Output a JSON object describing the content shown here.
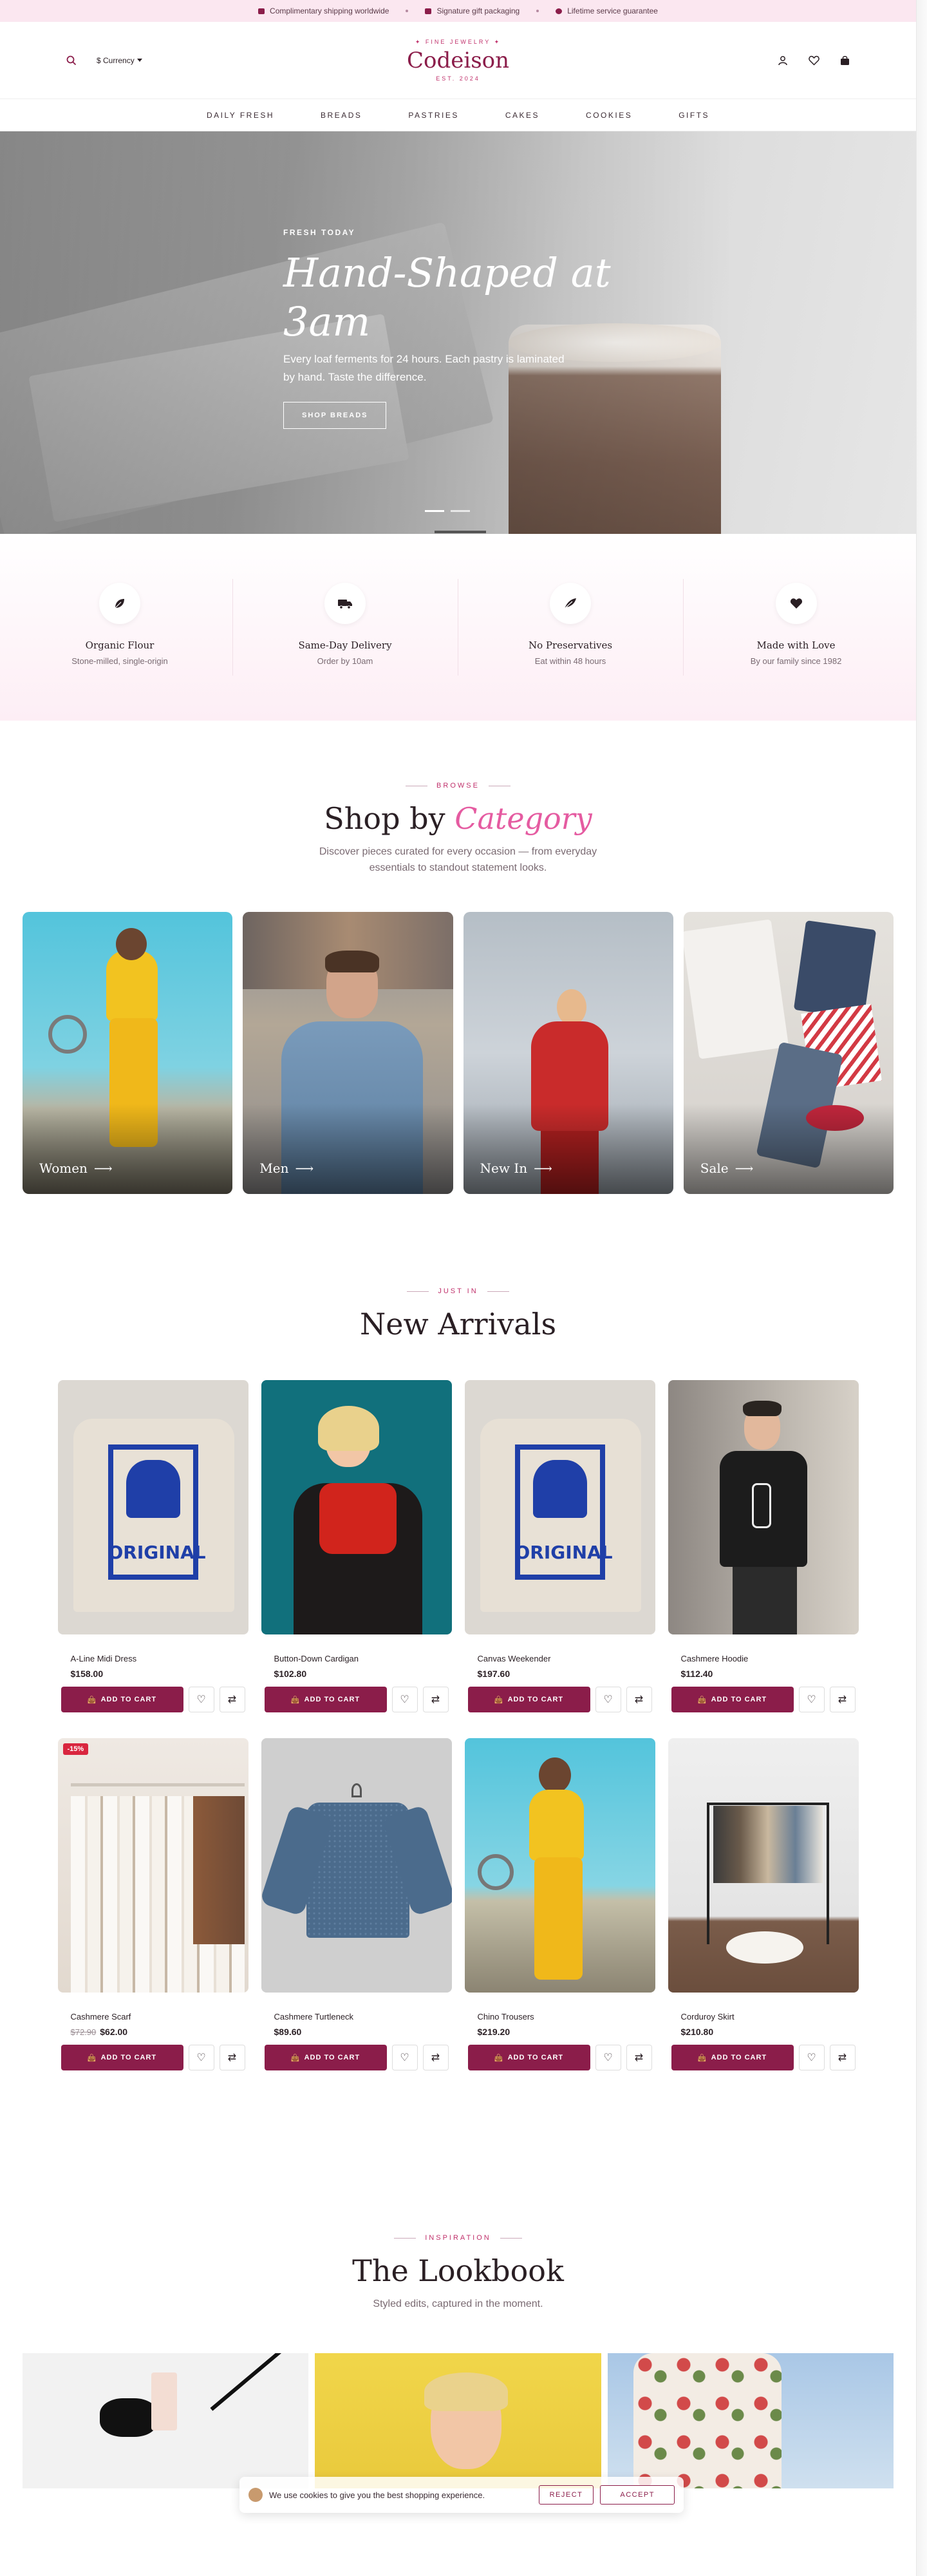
{
  "announcement": {
    "items": [
      "Complimentary shipping worldwide",
      "Signature gift packaging",
      "Lifetime service guarantee"
    ]
  },
  "header": {
    "currency_label": "$ Currency",
    "logo_tag": "✦ FINE JEWELRY ✦",
    "logo_name": "Codeison",
    "logo_est": "EST. 2024"
  },
  "nav": {
    "items": [
      "DAILY FRESH",
      "BREADS",
      "PASTRIES",
      "CAKES",
      "COOKIES",
      "GIFTS"
    ]
  },
  "hero": {
    "eyebrow": "FRESH TODAY",
    "title": "Hand-Shaped at 3am",
    "subtitle": "Every loaf ferments for 24 hours. Each pastry is laminated by hand. Taste the difference.",
    "button": "SHOP BREADS"
  },
  "features": [
    {
      "icon": "leaf-icon",
      "title": "Organic Flour",
      "desc": "Stone-milled, single-origin"
    },
    {
      "icon": "truck-icon",
      "title": "Same-Day Delivery",
      "desc": "Order by 10am"
    },
    {
      "icon": "feather-icon",
      "title": "No Preservatives",
      "desc": "Eat within 48 hours"
    },
    {
      "icon": "heart-icon",
      "title": "Made with Love",
      "desc": "By our family since 1982"
    }
  ],
  "categories_section": {
    "eyebrow": "BROWSE",
    "title_plain": "Shop by",
    "title_accent": "Category",
    "desc_line1": "Discover pieces curated for every occasion — from everyday",
    "desc_line2": "essentials to standout statement looks.",
    "items": [
      {
        "label": "Women"
      },
      {
        "label": "Men"
      },
      {
        "label": "New In"
      },
      {
        "label": "Sale"
      }
    ]
  },
  "arrivals": {
    "eyebrow": "JUST IN",
    "title": "New Arrivals",
    "add_label": "ADD TO CART",
    "products": [
      {
        "name": "A-Line Midi Dress",
        "price": "$158.00",
        "old_price": "",
        "badge": ""
      },
      {
        "name": "Button-Down Cardigan",
        "price": "$102.80",
        "old_price": "",
        "badge": ""
      },
      {
        "name": "Canvas Weekender",
        "price": "$197.60",
        "old_price": "",
        "badge": ""
      },
      {
        "name": "Cashmere Hoodie",
        "price": "$112.40",
        "old_price": "",
        "badge": ""
      },
      {
        "name": "Cashmere Scarf",
        "price": "$62.00",
        "old_price": "$72.90",
        "badge": "-15%"
      },
      {
        "name": "Cashmere Turtleneck",
        "price": "$89.60",
        "old_price": "",
        "badge": ""
      },
      {
        "name": "Chino Trousers",
        "price": "$219.20",
        "old_price": "",
        "badge": ""
      },
      {
        "name": "Corduroy Skirt",
        "price": "$210.80",
        "old_price": "",
        "badge": ""
      }
    ],
    "tee_print_text": "ORIGINAL"
  },
  "lookbook": {
    "eyebrow": "INSPIRATION",
    "title": "The Lookbook",
    "desc": "Styled edits, captured in the moment."
  },
  "cookie": {
    "text": "We use cookies to give you the best shopping experience.",
    "reject": "REJECT",
    "accept": "ACCEPT"
  },
  "colors": {
    "brand": "#8b1d4a",
    "accent": "#e55ba1",
    "announce_bg": "#fbe7f0"
  }
}
